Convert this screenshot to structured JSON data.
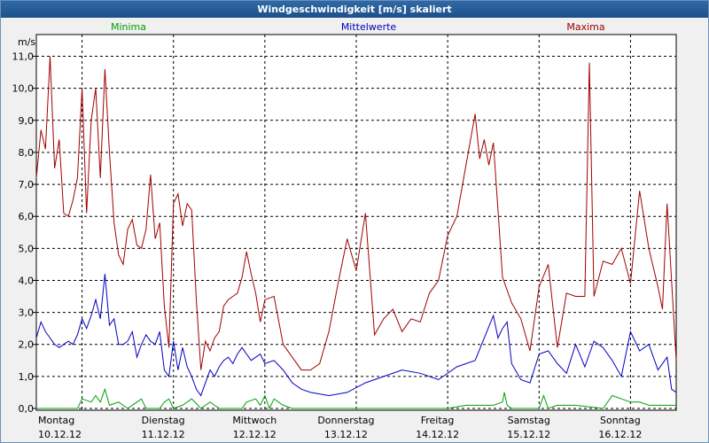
{
  "window": {
    "title": "Windgeschwindigkeit [m/s] skaliert"
  },
  "chart_data": {
    "type": "line",
    "title": "Windgeschwindigkeit [m/s] skaliert",
    "ylabel": "m/s",
    "xlabel": "",
    "ylim": [
      0,
      11.5
    ],
    "xlim": [
      0,
      7
    ],
    "yticks": [
      0,
      1,
      2,
      3,
      4,
      5,
      6,
      7,
      8,
      9,
      10,
      11
    ],
    "ytick_labels": [
      "0,0",
      "1,0",
      "2,0",
      "3,0",
      "4,0",
      "5,0",
      "6,0",
      "7,0",
      "8,0",
      "9,0",
      "10,0",
      "11,0"
    ],
    "grid": true,
    "legend_position": "top",
    "x_ticks": [
      {
        "day": "Montag",
        "date": "10.12.12"
      },
      {
        "day": "Dienstag",
        "date": "11.12.12"
      },
      {
        "day": "Mittwoch",
        "date": "12.12.12"
      },
      {
        "day": "Donnerstag",
        "date": "13.12.12"
      },
      {
        "day": "Freitag",
        "date": "14.12.12"
      },
      {
        "day": "Samstag",
        "date": "15.12.12"
      },
      {
        "day": "Sonntag",
        "date": "16.12.12"
      }
    ],
    "series": [
      {
        "name": "Minima",
        "color": "#00a000",
        "x": [
          0,
          0.3,
          0.45,
          0.5,
          0.6,
          0.65,
          0.7,
          0.75,
          0.8,
          0.9,
          0.95,
          1.0,
          1.1,
          1.15,
          1.2,
          1.35,
          1.4,
          1.45,
          1.5,
          1.6,
          1.7,
          1.8,
          1.9,
          2.0,
          2.1,
          2.25,
          2.3,
          2.4,
          2.45,
          2.5,
          2.55,
          2.6,
          2.7,
          2.8,
          3.0,
          3.5,
          4.0,
          4.5,
          4.7,
          5.0,
          5.1,
          5.12,
          5.15,
          5.2,
          5.5,
          5.55,
          5.6,
          5.7,
          5.9,
          6.2,
          6.3,
          6.4,
          6.5,
          6.6,
          6.7,
          6.8,
          7.0
        ],
        "y": [
          0,
          0,
          0,
          0.3,
          0.2,
          0.4,
          0.2,
          0.6,
          0.1,
          0.2,
          0.1,
          0,
          0.2,
          0.3,
          0,
          0,
          0.2,
          0.3,
          0,
          0.1,
          0.3,
          0,
          0.2,
          0,
          0,
          0,
          0.2,
          0.3,
          0.1,
          0.4,
          0,
          0.3,
          0.1,
          0,
          0,
          0,
          0,
          0,
          0.1,
          0.1,
          0.2,
          0.5,
          0.1,
          0,
          0,
          0.4,
          0,
          0.1,
          0.1,
          0,
          0.4,
          0.3,
          0.2,
          0.2,
          0.1,
          0.1,
          0.1
        ]
      },
      {
        "name": "Mittelwerte",
        "color": "#0000c0",
        "x": [
          0,
          0.05,
          0.1,
          0.15,
          0.2,
          0.25,
          0.3,
          0.35,
          0.4,
          0.45,
          0.5,
          0.55,
          0.6,
          0.65,
          0.7,
          0.75,
          0.8,
          0.85,
          0.9,
          0.95,
          1.0,
          1.05,
          1.1,
          1.15,
          1.2,
          1.25,
          1.3,
          1.35,
          1.4,
          1.45,
          1.5,
          1.55,
          1.6,
          1.65,
          1.7,
          1.75,
          1.8,
          1.85,
          1.9,
          1.95,
          2.0,
          2.05,
          2.1,
          2.15,
          2.2,
          2.25,
          2.3,
          2.35,
          2.4,
          2.45,
          2.5,
          2.6,
          2.7,
          2.8,
          2.9,
          3.0,
          3.2,
          3.4,
          3.6,
          3.8,
          4.0,
          4.2,
          4.4,
          4.6,
          4.8,
          5.0,
          5.05,
          5.1,
          5.15,
          5.2,
          5.3,
          5.4,
          5.5,
          5.6,
          5.7,
          5.8,
          5.9,
          6.0,
          6.1,
          6.2,
          6.3,
          6.4,
          6.5,
          6.6,
          6.7,
          6.8,
          6.9,
          6.95,
          7.0
        ],
        "y": [
          2.2,
          2.7,
          2.4,
          2.2,
          2.0,
          1.9,
          2.0,
          2.1,
          2.0,
          2.3,
          2.8,
          2.5,
          2.9,
          3.4,
          2.8,
          4.2,
          2.6,
          2.8,
          2.0,
          2.0,
          2.1,
          2.4,
          1.6,
          2.0,
          2.3,
          2.1,
          2.0,
          2.4,
          1.2,
          1.0,
          2.1,
          1.2,
          1.9,
          1.3,
          1.0,
          0.6,
          0.4,
          0.8,
          1.2,
          1.0,
          1.3,
          1.5,
          1.6,
          1.4,
          1.7,
          1.9,
          1.7,
          1.5,
          1.6,
          1.7,
          1.4,
          1.5,
          1.2,
          0.8,
          0.6,
          0.5,
          0.4,
          0.5,
          0.8,
          1.0,
          1.2,
          1.1,
          0.9,
          1.3,
          1.5,
          2.9,
          2.2,
          2.5,
          2.7,
          1.4,
          0.9,
          0.8,
          1.7,
          1.8,
          1.4,
          1.1,
          2.0,
          1.3,
          2.1,
          1.9,
          1.5,
          1.0,
          2.4,
          1.8,
          2.0,
          1.2,
          1.6,
          0.6,
          0.5
        ]
      },
      {
        "name": "Maxima",
        "color": "#a00000",
        "x": [
          0,
          0.05,
          0.1,
          0.15,
          0.2,
          0.25,
          0.3,
          0.35,
          0.4,
          0.45,
          0.5,
          0.55,
          0.6,
          0.65,
          0.7,
          0.75,
          0.8,
          0.85,
          0.9,
          0.95,
          1.0,
          1.05,
          1.1,
          1.15,
          1.2,
          1.25,
          1.3,
          1.35,
          1.4,
          1.45,
          1.5,
          1.55,
          1.6,
          1.65,
          1.7,
          1.75,
          1.8,
          1.85,
          1.9,
          1.95,
          2.0,
          2.05,
          2.1,
          2.15,
          2.2,
          2.25,
          2.3,
          2.35,
          2.4,
          2.45,
          2.5,
          2.6,
          2.7,
          2.8,
          2.9,
          3.0,
          3.1,
          3.2,
          3.3,
          3.4,
          3.5,
          3.6,
          3.7,
          3.8,
          3.9,
          4.0,
          4.1,
          4.2,
          4.3,
          4.4,
          4.5,
          4.6,
          4.7,
          4.8,
          4.85,
          4.9,
          4.95,
          5.0,
          5.05,
          5.1,
          5.2,
          5.3,
          5.4,
          5.5,
          5.6,
          5.7,
          5.8,
          5.9,
          6.0,
          6.05,
          6.1,
          6.2,
          6.3,
          6.4,
          6.5,
          6.6,
          6.7,
          6.8,
          6.85,
          6.9,
          7.0
        ],
        "y": [
          7.2,
          8.7,
          8.1,
          11.0,
          7.5,
          8.4,
          6.1,
          6.0,
          6.5,
          7.2,
          10.0,
          6.1,
          9.0,
          10.0,
          7.2,
          10.6,
          8.0,
          5.8,
          4.8,
          4.5,
          5.6,
          5.9,
          5.1,
          5.0,
          5.6,
          7.3,
          5.3,
          5.8,
          3.2,
          1.9,
          6.4,
          6.7,
          5.7,
          6.4,
          6.2,
          3.4,
          1.2,
          2.1,
          1.8,
          2.2,
          2.4,
          3.2,
          3.4,
          3.5,
          3.6,
          4.1,
          4.9,
          4.2,
          3.6,
          2.7,
          3.4,
          3.5,
          2.0,
          1.6,
          1.2,
          1.2,
          1.4,
          2.4,
          3.9,
          5.3,
          4.3,
          6.1,
          2.3,
          2.8,
          3.1,
          2.4,
          2.8,
          2.7,
          3.6,
          4.0,
          5.4,
          6.0,
          7.6,
          9.2,
          7.8,
          8.4,
          7.6,
          8.3,
          6.2,
          4.1,
          3.3,
          2.8,
          1.8,
          3.8,
          4.5,
          1.9,
          3.6,
          3.5,
          3.5,
          10.8,
          3.5,
          4.6,
          4.5,
          5.0,
          3.9,
          6.8,
          5.0,
          3.8,
          3.1,
          6.4,
          1.5
        ]
      }
    ]
  }
}
